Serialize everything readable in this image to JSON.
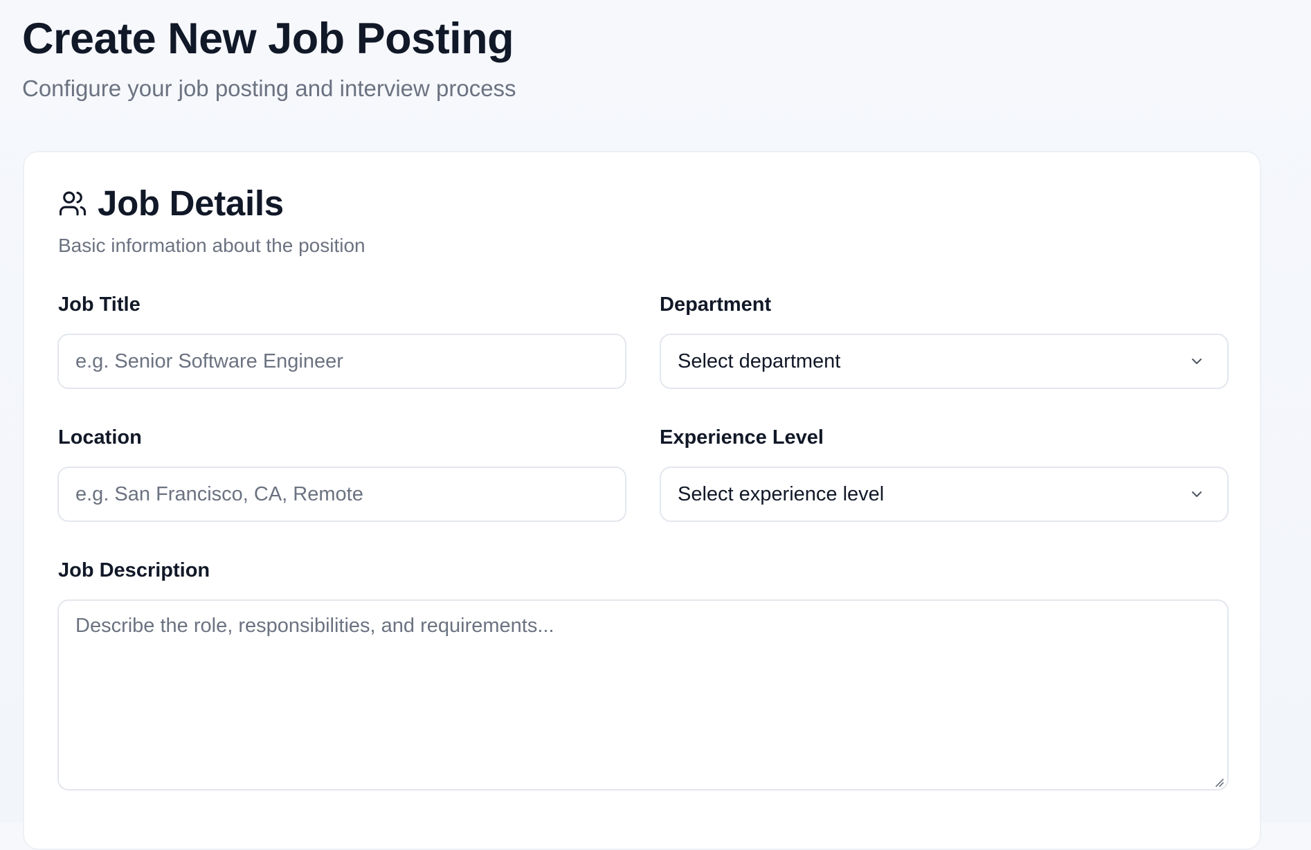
{
  "page": {
    "title": "Create New Job Posting",
    "subtitle": "Configure your job posting and interview process"
  },
  "job_details": {
    "icon": "users-icon",
    "title": "Job Details",
    "subtitle": "Basic information about the position",
    "fields": {
      "job_title": {
        "label": "Job Title",
        "value": "",
        "placeholder": "e.g. Senior Software Engineer"
      },
      "department": {
        "label": "Department",
        "selected": "Select department",
        "icon": "chevron-down-icon"
      },
      "location": {
        "label": "Location",
        "value": "",
        "placeholder": "e.g. San Francisco, CA, Remote"
      },
      "experience_level": {
        "label": "Experience Level",
        "selected": "Select experience level",
        "icon": "chevron-down-icon"
      },
      "job_description": {
        "label": "Job Description",
        "value": "",
        "placeholder": "Describe the role, responsibilities, and requirements..."
      }
    }
  },
  "colors": {
    "background": "#f4f7fb",
    "card": "#ffffff",
    "border": "#e3e7ed",
    "heading": "#111827",
    "muted": "#6b7280"
  }
}
